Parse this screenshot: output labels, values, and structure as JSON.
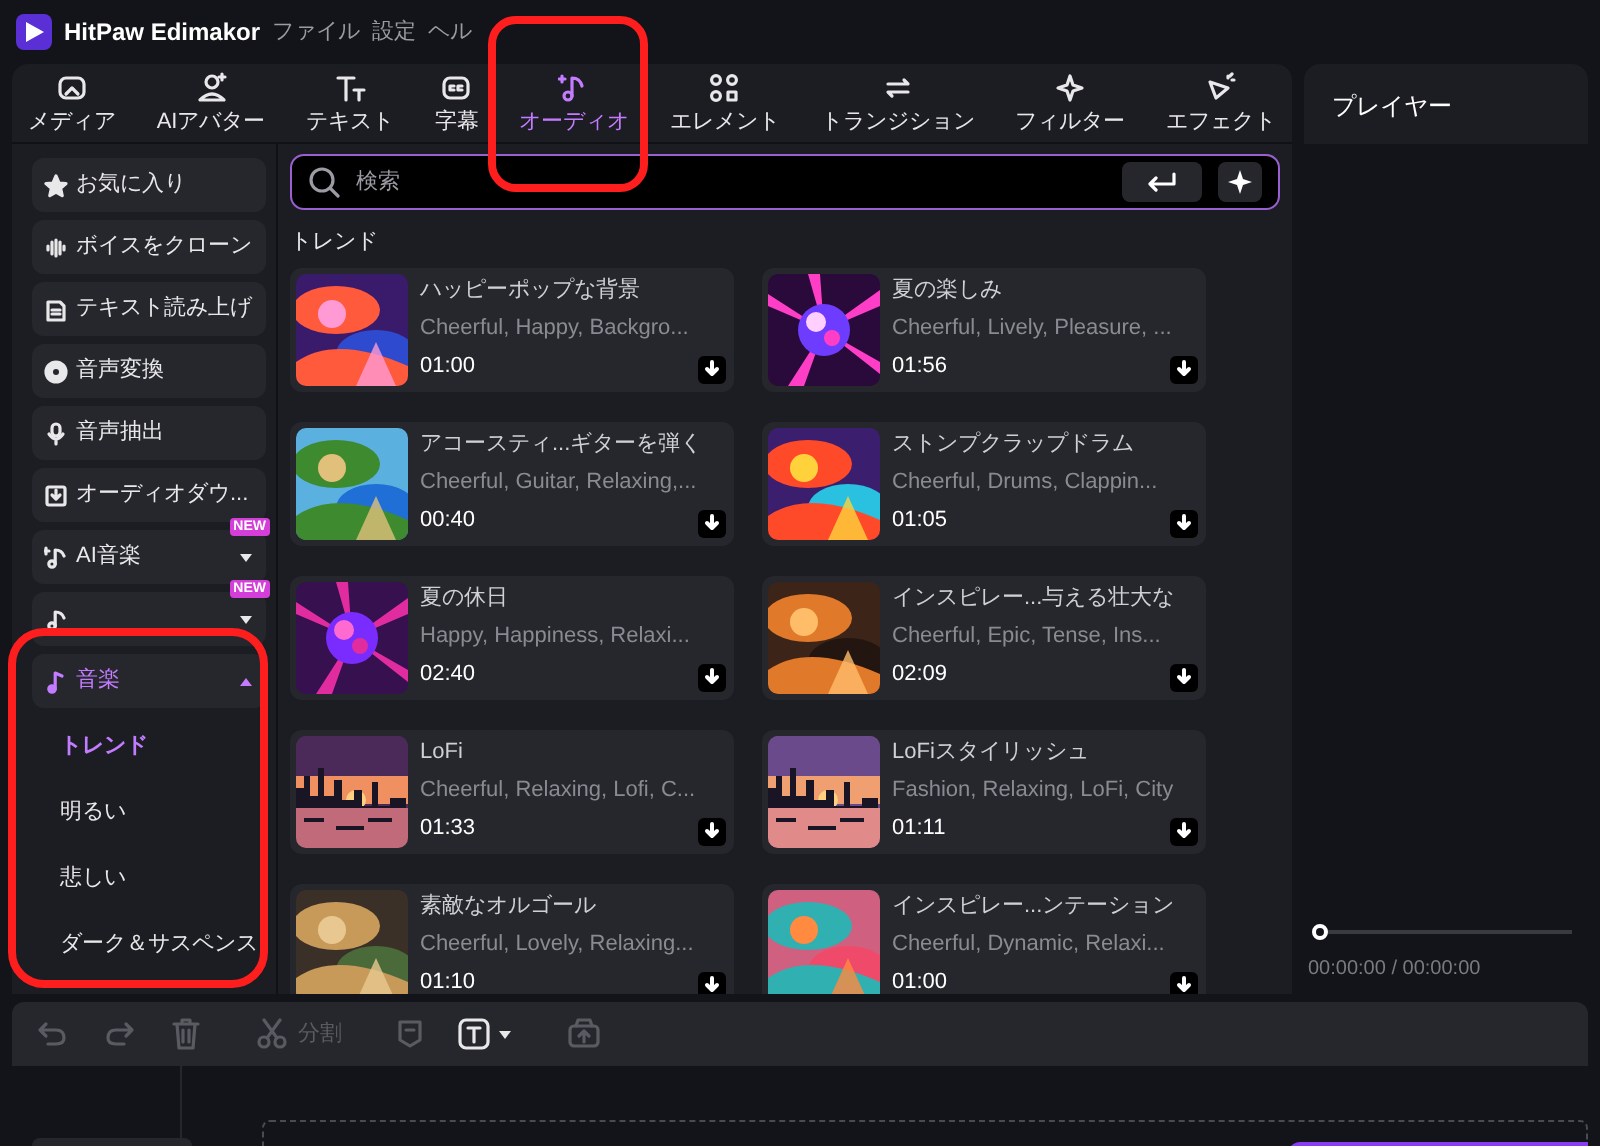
{
  "app": {
    "title": "HitPaw Edimakor",
    "menu": [
      "ファイル",
      "設定",
      "ヘル"
    ]
  },
  "tabs": [
    {
      "label": "メディア",
      "selected": false
    },
    {
      "label": "AIアバター",
      "selected": false
    },
    {
      "label": "テキスト",
      "selected": false
    },
    {
      "label": "字幕",
      "selected": false
    },
    {
      "label": "オーディオ",
      "selected": true
    },
    {
      "label": "エレメント",
      "selected": false
    },
    {
      "label": "トランジション",
      "selected": false
    },
    {
      "label": "フィルター",
      "selected": false
    },
    {
      "label": "エフェクト",
      "selected": false
    }
  ],
  "sidebar": [
    {
      "kind": "item",
      "label": "お気に入り"
    },
    {
      "kind": "item",
      "label": "ボイスをクローン"
    },
    {
      "kind": "item",
      "label": "テキスト読み上げ"
    },
    {
      "kind": "item",
      "label": "音声変換"
    },
    {
      "kind": "item",
      "label": "音声抽出"
    },
    {
      "kind": "item",
      "label": "オーディオダウ..."
    },
    {
      "kind": "group",
      "label": "AI音楽",
      "badge": "NEW",
      "expanded": false
    },
    {
      "kind": "group",
      "badge": "NEW",
      "expanded": false
    },
    {
      "kind": "group",
      "label": "音楽",
      "expanded": true,
      "children": [
        {
          "label": "トレンド",
          "selected": true
        },
        {
          "label": "明るい",
          "selected": false
        },
        {
          "label": "悲しい",
          "selected": false
        },
        {
          "label": "ダーク＆サスペンス",
          "selected": false
        }
      ]
    }
  ],
  "search": {
    "placeholder": "検索"
  },
  "section_title": "トレンド",
  "tracks": [
    {
      "title": "ハッピーポップな背景",
      "tags": "Cheerful, Happy, Backgro...",
      "duration": "01:00"
    },
    {
      "title": "夏の楽しみ",
      "tags": "Cheerful, Lively, Pleasure, ...",
      "duration": "01:56"
    },
    {
      "title": "アコースティ...ギターを弾く",
      "tags": "Cheerful, Guitar, Relaxing,...",
      "duration": "00:40"
    },
    {
      "title": "ストンプクラップドラム",
      "tags": "Cheerful, Drums, Clappin...",
      "duration": "01:05"
    },
    {
      "title": "夏の休日",
      "tags": "Happy, Happiness, Relaxi...",
      "duration": "02:40"
    },
    {
      "title": "インスピレー...与える壮大な",
      "tags": "Cheerful, Epic, Tense, Ins...",
      "duration": "02:09"
    },
    {
      "title": "LoFi",
      "tags": "Cheerful, Relaxing, Lofi, C...",
      "duration": "01:33"
    },
    {
      "title": "LoFiスタイリッシュ",
      "tags": "Fashion, Relaxing, LoFi, City",
      "duration": "01:11"
    },
    {
      "title": "素敵なオルゴール",
      "tags": "Cheerful, Lovely, Relaxing...",
      "duration": "01:10"
    },
    {
      "title": "インスピレー...ンテーション",
      "tags": "Cheerful, Dynamic, Relaxi...",
      "duration": "01:00"
    }
  ],
  "player": {
    "title": "プレイヤー",
    "time": "00:00:00 / 00:00:00",
    "level": 0
  },
  "toolbar": {
    "split_label": "分割"
  }
}
